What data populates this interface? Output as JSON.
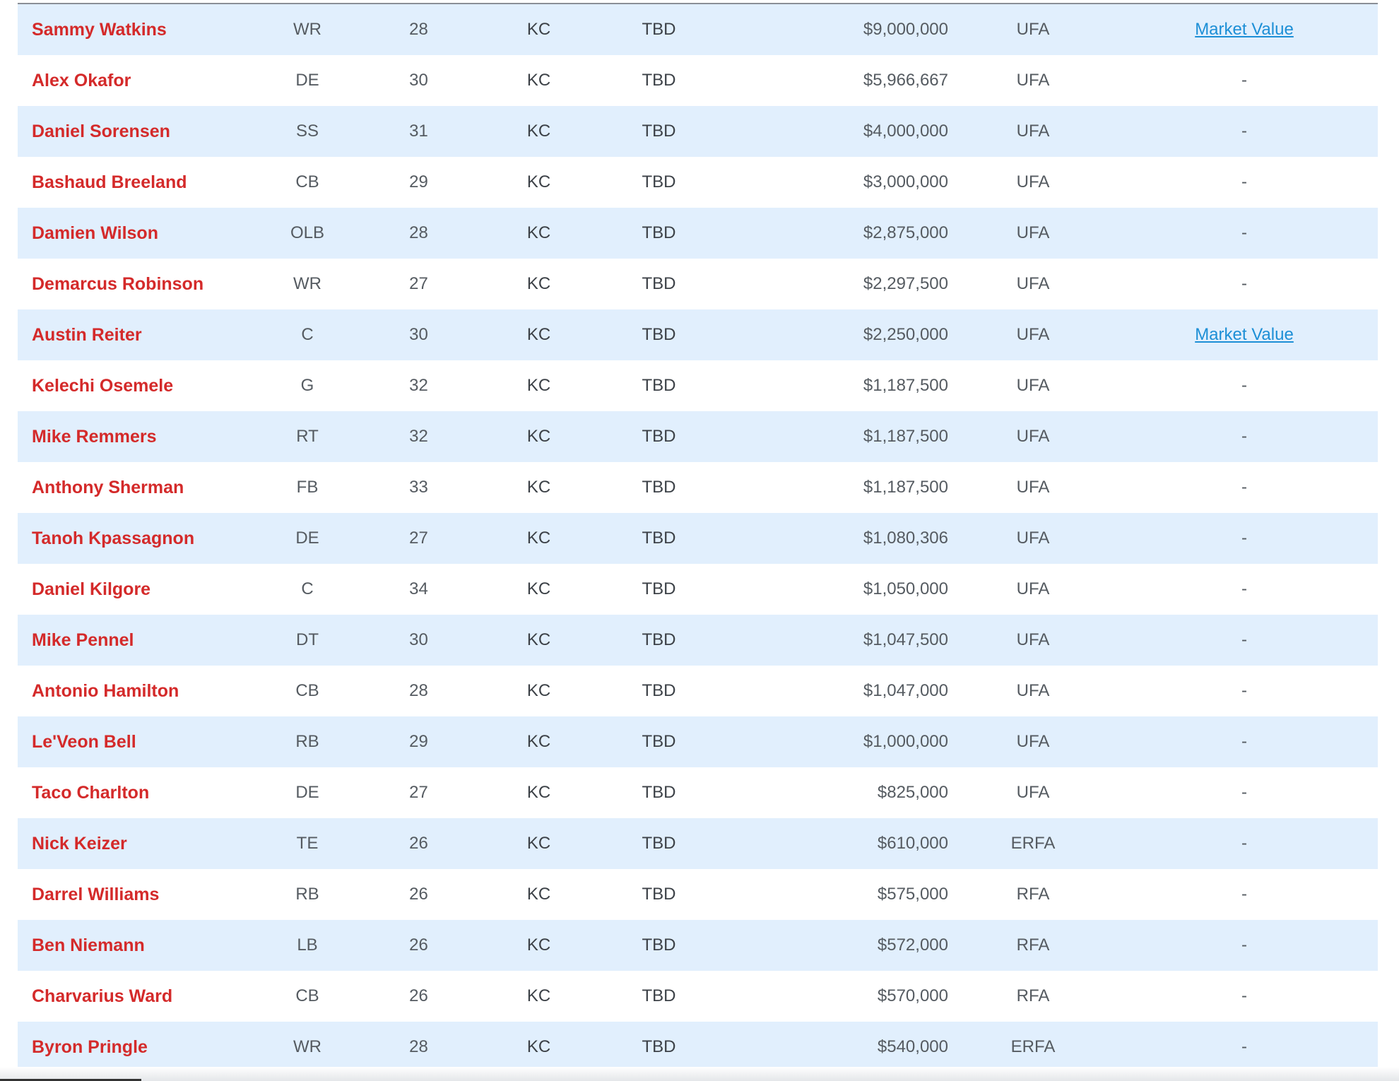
{
  "players": [
    {
      "name": "Sammy Watkins",
      "pos": "WR",
      "age": "28",
      "team": "KC",
      "status": "TBD",
      "salary": "$9,000,000",
      "type": "UFA",
      "link": "Market Value"
    },
    {
      "name": "Alex Okafor",
      "pos": "DE",
      "age": "30",
      "team": "KC",
      "status": "TBD",
      "salary": "$5,966,667",
      "type": "UFA",
      "link": "-"
    },
    {
      "name": "Daniel Sorensen",
      "pos": "SS",
      "age": "31",
      "team": "KC",
      "status": "TBD",
      "salary": "$4,000,000",
      "type": "UFA",
      "link": "-"
    },
    {
      "name": "Bashaud Breeland",
      "pos": "CB",
      "age": "29",
      "team": "KC",
      "status": "TBD",
      "salary": "$3,000,000",
      "type": "UFA",
      "link": "-"
    },
    {
      "name": "Damien Wilson",
      "pos": "OLB",
      "age": "28",
      "team": "KC",
      "status": "TBD",
      "salary": "$2,875,000",
      "type": "UFA",
      "link": "-"
    },
    {
      "name": "Demarcus Robinson",
      "pos": "WR",
      "age": "27",
      "team": "KC",
      "status": "TBD",
      "salary": "$2,297,500",
      "type": "UFA",
      "link": "-"
    },
    {
      "name": "Austin Reiter",
      "pos": "C",
      "age": "30",
      "team": "KC",
      "status": "TBD",
      "salary": "$2,250,000",
      "type": "UFA",
      "link": "Market Value"
    },
    {
      "name": "Kelechi Osemele",
      "pos": "G",
      "age": "32",
      "team": "KC",
      "status": "TBD",
      "salary": "$1,187,500",
      "type": "UFA",
      "link": "-"
    },
    {
      "name": "Mike Remmers",
      "pos": "RT",
      "age": "32",
      "team": "KC",
      "status": "TBD",
      "salary": "$1,187,500",
      "type": "UFA",
      "link": "-"
    },
    {
      "name": "Anthony Sherman",
      "pos": "FB",
      "age": "33",
      "team": "KC",
      "status": "TBD",
      "salary": "$1,187,500",
      "type": "UFA",
      "link": "-"
    },
    {
      "name": "Tanoh Kpassagnon",
      "pos": "DE",
      "age": "27",
      "team": "KC",
      "status": "TBD",
      "salary": "$1,080,306",
      "type": "UFA",
      "link": "-"
    },
    {
      "name": "Daniel Kilgore",
      "pos": "C",
      "age": "34",
      "team": "KC",
      "status": "TBD",
      "salary": "$1,050,000",
      "type": "UFA",
      "link": "-"
    },
    {
      "name": "Mike Pennel",
      "pos": "DT",
      "age": "30",
      "team": "KC",
      "status": "TBD",
      "salary": "$1,047,500",
      "type": "UFA",
      "link": "-"
    },
    {
      "name": "Antonio Hamilton",
      "pos": "CB",
      "age": "28",
      "team": "KC",
      "status": "TBD",
      "salary": "$1,047,000",
      "type": "UFA",
      "link": "-"
    },
    {
      "name": "Le'Veon Bell",
      "pos": "RB",
      "age": "29",
      "team": "KC",
      "status": "TBD",
      "salary": "$1,000,000",
      "type": "UFA",
      "link": "-"
    },
    {
      "name": "Taco Charlton",
      "pos": "DE",
      "age": "27",
      "team": "KC",
      "status": "TBD",
      "salary": "$825,000",
      "type": "UFA",
      "link": "-"
    },
    {
      "name": "Nick Keizer",
      "pos": "TE",
      "age": "26",
      "team": "KC",
      "status": "TBD",
      "salary": "$610,000",
      "type": "ERFA",
      "link": "-"
    },
    {
      "name": "Darrel Williams",
      "pos": "RB",
      "age": "26",
      "team": "KC",
      "status": "TBD",
      "salary": "$575,000",
      "type": "RFA",
      "link": "-"
    },
    {
      "name": "Ben Niemann",
      "pos": "LB",
      "age": "26",
      "team": "KC",
      "status": "TBD",
      "salary": "$572,000",
      "type": "RFA",
      "link": "-"
    },
    {
      "name": "Charvarius Ward",
      "pos": "CB",
      "age": "26",
      "team": "KC",
      "status": "TBD",
      "salary": "$570,000",
      "type": "RFA",
      "link": "-"
    },
    {
      "name": "Byron Pringle",
      "pos": "WR",
      "age": "28",
      "team": "KC",
      "status": "TBD",
      "salary": "$540,000",
      "type": "ERFA",
      "link": "-"
    }
  ],
  "colors": {
    "name_red": "#d42a2a",
    "stripe_blue": "#e1effd",
    "link_blue": "#1d8fd6"
  }
}
